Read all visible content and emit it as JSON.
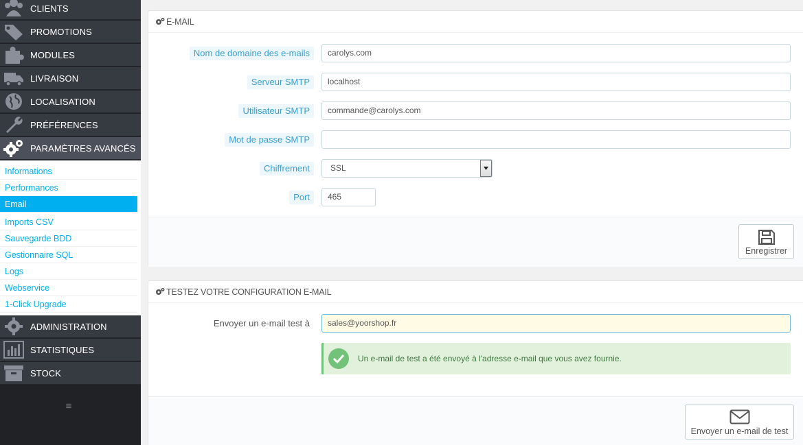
{
  "sidebar": {
    "items": [
      {
        "label": "CLIENTS",
        "icon": "users-icon"
      },
      {
        "label": "PROMOTIONS",
        "icon": "tags-icon"
      },
      {
        "label": "MODULES",
        "icon": "puzzle-icon"
      },
      {
        "label": "LIVRAISON",
        "icon": "truck-icon"
      },
      {
        "label": "LOCALISATION",
        "icon": "globe-icon"
      },
      {
        "label": "PRÉFÉRENCES",
        "icon": "wrench-icon"
      },
      {
        "label": "PARAMÈTRES AVANCÉS",
        "icon": "cogs-icon"
      },
      {
        "label": "ADMINISTRATION",
        "icon": "cog-icon"
      },
      {
        "label": "STATISTIQUES",
        "icon": "bar-chart-icon"
      },
      {
        "label": "STOCK",
        "icon": "archive-icon"
      }
    ],
    "submenu": [
      "Informations",
      "Performances",
      "Email",
      "Imports CSV",
      "Sauvegarde BDD",
      "Gestionnaire SQL",
      "Logs",
      "Webservice",
      "1-Click Upgrade"
    ],
    "active_sub": "Email"
  },
  "email_panel": {
    "title": "E-MAIL",
    "fields": {
      "domain_label": "Nom de domaine des e-mails",
      "domain_value": "carolys.com",
      "smtp_server_label": "Serveur SMTP",
      "smtp_server_value": "localhost",
      "smtp_user_label": "Utilisateur SMTP",
      "smtp_user_value": "commande@carolys.com",
      "smtp_pass_label": "Mot de passe SMTP",
      "smtp_pass_value": "",
      "encryption_label": "Chiffrement",
      "encryption_value": "SSL",
      "port_label": "Port",
      "port_value": "465"
    },
    "save_label": "Enregistrer"
  },
  "test_panel": {
    "title": "TESTEZ VOTRE CONFIGURATION E-MAIL",
    "send_to_label": "Envoyer un e-mail test à",
    "send_to_value": "sales@yoorshop.fr",
    "success_message": "Un e-mail de test a été envoyé à l'adresse e-mail que vous avez fournie.",
    "send_label": "Envoyer un e-mail de test"
  },
  "colors": {
    "accent": "#00aff0",
    "sidebar_bg": "#363a41",
    "success": "#72c279"
  }
}
